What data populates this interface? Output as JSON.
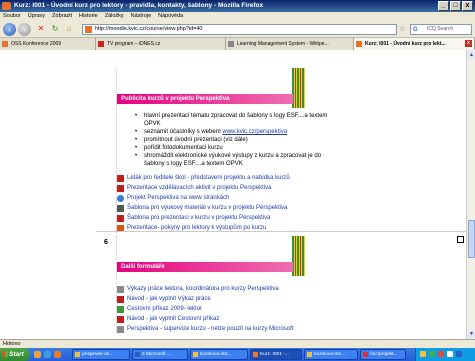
{
  "window": {
    "title": "Kurz: I001 - Úvodní kurz pro lektory - pravidla, kontakty, šablony - Mozilla Firefox",
    "controls": [
      "_",
      "□",
      "x"
    ]
  },
  "menu": [
    "Soubor",
    "Úpravy",
    "Zobrazit",
    "Historie",
    "Záložky",
    "Nástroje",
    "Nápověda"
  ],
  "toolbar": {
    "url": "http://moodle.kvic.cz/course/view.php?id=40",
    "search_placeholder": "ICQ Search"
  },
  "tabs": [
    {
      "label": "OSS Konference 2009",
      "active": false
    },
    {
      "label": "TV program – iDNES.cz",
      "active": false
    },
    {
      "label": "Learning Management System - Wikipe...",
      "active": false
    },
    {
      "label": "Kurz: I001 - Úvodní kurz pro lekt...",
      "active": true
    }
  ],
  "sections": [
    {
      "number": "",
      "banner": "Publicita kurzů v projektu Perspektiva",
      "bullets": [
        "hlavní prezentaci tématu zpracovat do šablony s logy ESF....a textem OPVK",
        "seznámit účastníky s webem www.kvic.cz/perspektiva",
        "promítnout úvodní prezentaci (viz dále)",
        "pořídit fotodokumentaci kurzu",
        "shromáždit elektronické výukové výstupy z kurzu a zpracovat je do šablony s logy ESF....a textem OPVK"
      ],
      "bullet_link": "www.kvic.cz/perspektiva",
      "resources": [
        {
          "icon": "pdf",
          "label": "Leták pro ředitele škol - představení projektu a nabídka kurzů"
        },
        {
          "icon": "pdf",
          "label": "Prezentace vzdělávacích aktivit v projektu Perspektiva"
        },
        {
          "icon": "web",
          "label": "Projekt Perspektiva na www stránkách"
        },
        {
          "icon": "lst",
          "label": "Šablona pro výukový materiál v kurzu v projektu Perspektiva"
        },
        {
          "icon": "pdf",
          "label": "Šablona pro prezentaci v kurzu v projektu Perspektiva"
        },
        {
          "icon": "ppt",
          "label": "Prezentace- pokyny pro lektory k výstupům po kurzu"
        }
      ]
    },
    {
      "number": "6",
      "banner": "Další formuláře",
      "resources": [
        {
          "icon": "frm",
          "label": "Výkazy práce lektora, koordinátora pro kurzy Perspektiva"
        },
        {
          "icon": "pdf",
          "label": "Návod - jak vyplnit Výkaz práce"
        },
        {
          "icon": "exe",
          "label": "Cestovní příkaz 2009- lektor"
        },
        {
          "icon": "pdf",
          "label": "Návod - jak vyplnit Cestovní příkaz"
        },
        {
          "icon": "frm",
          "label": "Perspektiva - supervize kurzu - nelze pouzit na kurzy Microsoft"
        }
      ]
    }
  ],
  "status": "Hotovo",
  "taskbar": {
    "start": "Start",
    "tasks": [
      {
        "label": "prispevek-do...",
        "active": false
      },
      {
        "label": "2 Microsoft ...",
        "active": false
      },
      {
        "label": "kozelova-obr...",
        "active": false
      },
      {
        "label": "Kurz: I001 -...",
        "active": true
      },
      {
        "label": "kozelova-mo...",
        "active": false
      },
      {
        "label": "\\\\nc\\projekt...",
        "active": false
      }
    ]
  }
}
